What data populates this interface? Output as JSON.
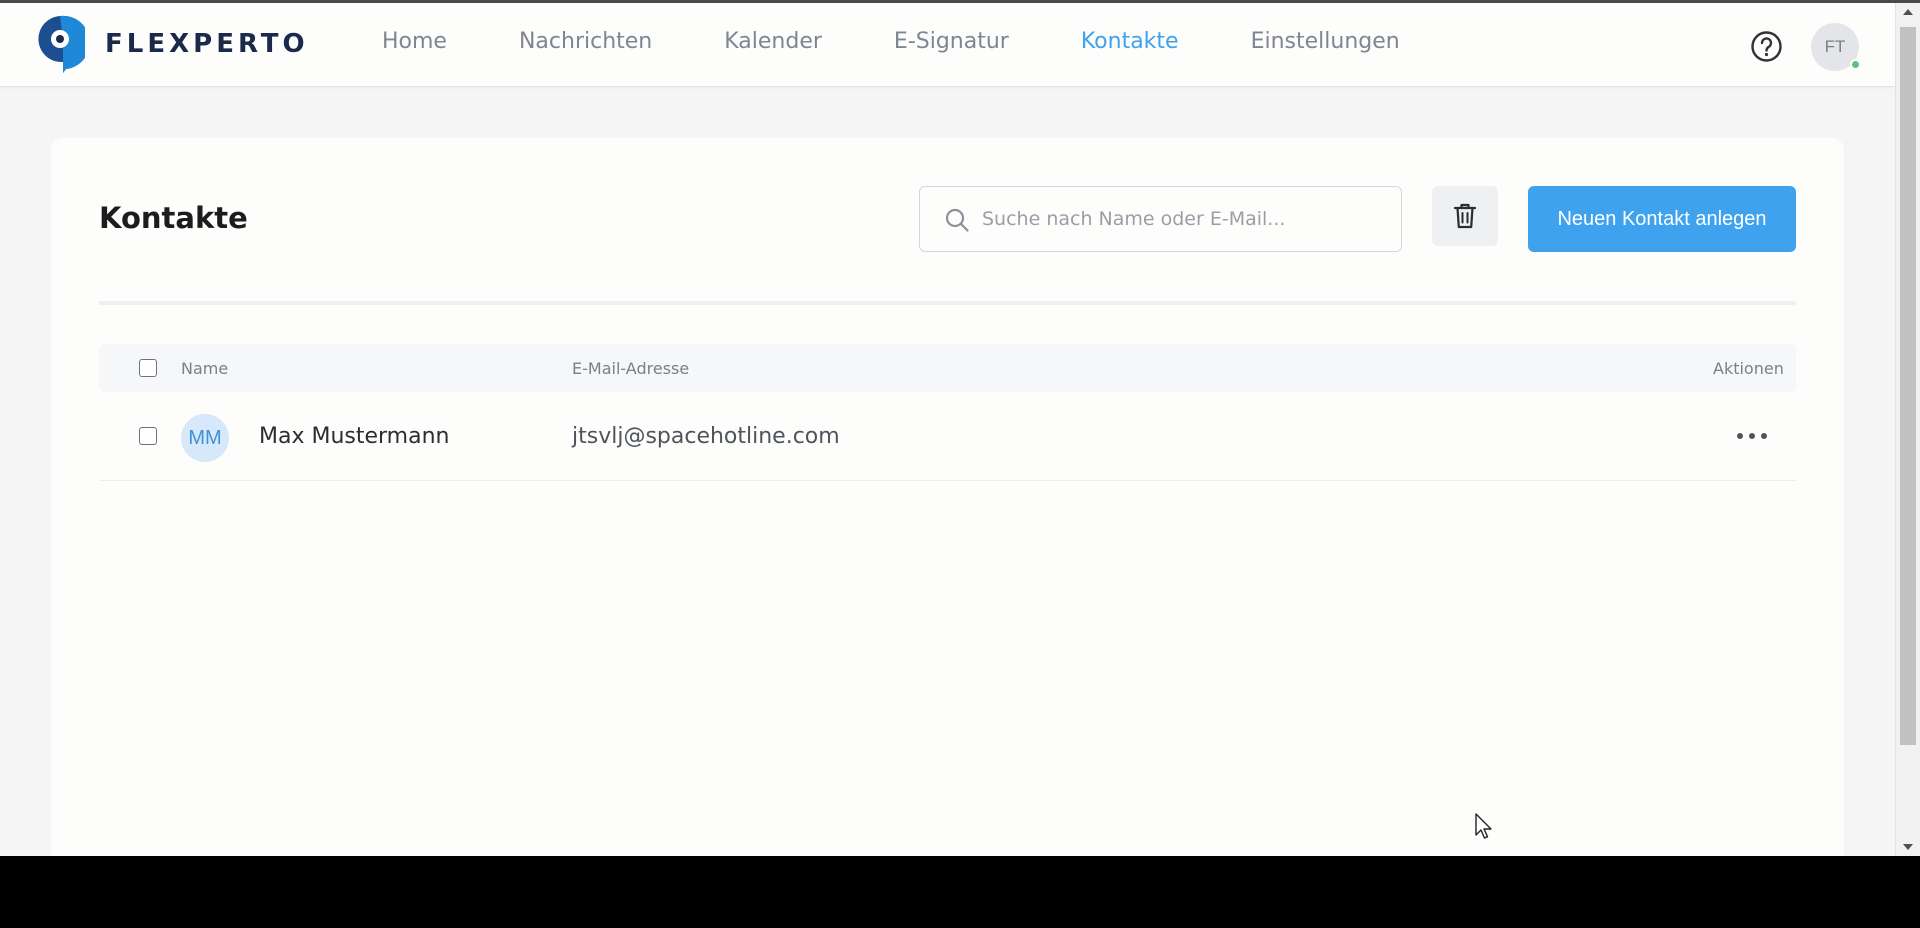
{
  "brand": {
    "name": "FLEXPERTO"
  },
  "nav": {
    "items": [
      {
        "label": "Home"
      },
      {
        "label": "Nachrichten"
      },
      {
        "label": "Kalender"
      },
      {
        "label": "E-Signatur"
      },
      {
        "label": "Kontakte",
        "active": true
      },
      {
        "label": "Einstellungen"
      }
    ],
    "active_color": "#3ea2ee"
  },
  "header": {
    "help_icon": "question-circle-icon",
    "user_initials": "FT",
    "user_status": "online"
  },
  "page": {
    "title": "Kontakte",
    "search_placeholder": "Suche nach Name oder E-Mail...",
    "search_value": "",
    "delete_icon": "trash-icon",
    "new_contact_label": "Neuen Kontakt anlegen"
  },
  "table": {
    "columns": {
      "name": "Name",
      "email": "E-Mail-Adresse",
      "actions": "Aktionen"
    },
    "rows": [
      {
        "initials": "MM",
        "name": "Max Mustermann",
        "email": "jtsvlj@spacehotline.com",
        "actions_icon": "more-horizontal-icon"
      }
    ]
  },
  "colors": {
    "accent": "#3ea2ee",
    "brand_dark": "#1b2a4a",
    "online": "#5cc27c"
  }
}
